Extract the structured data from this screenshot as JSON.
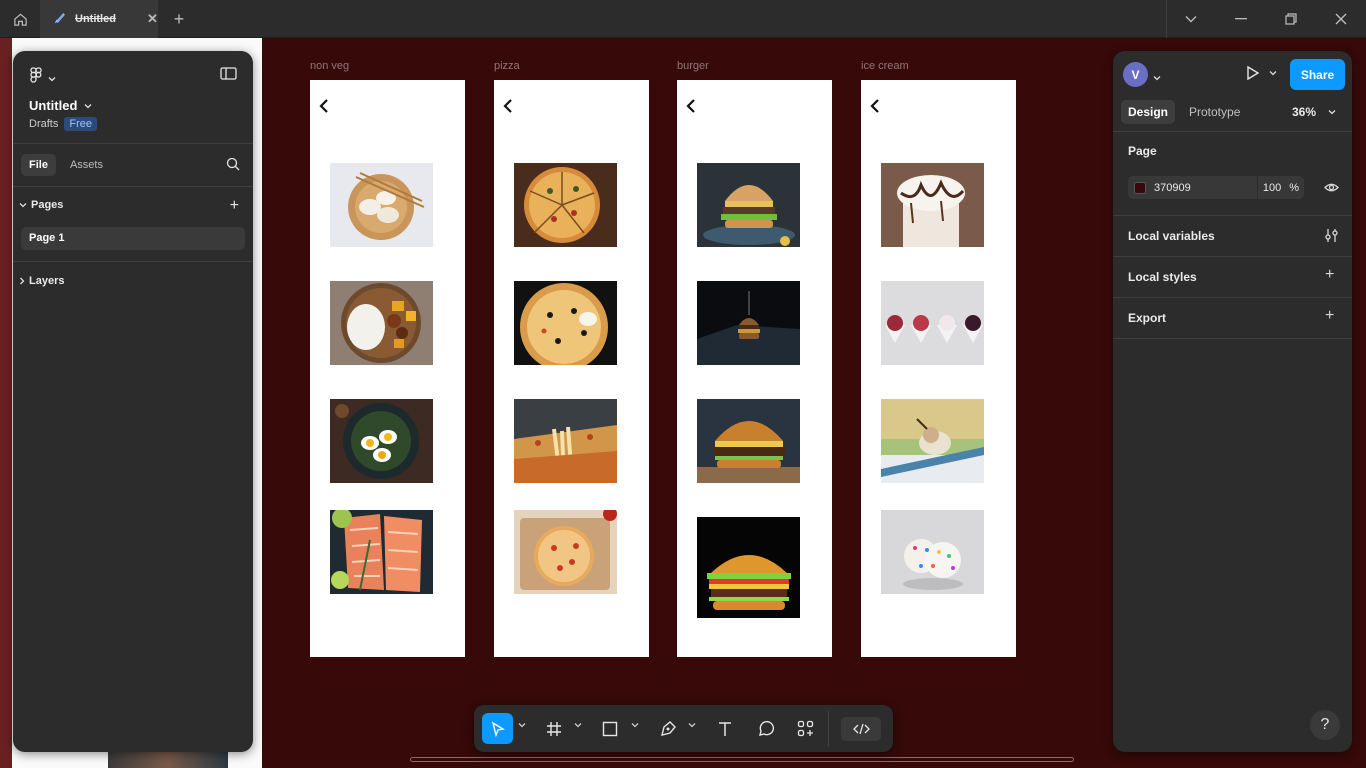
{
  "titlebar": {
    "tab_title": "Untitled",
    "tab_close": "✕",
    "new_tab": "+"
  },
  "file": {
    "name": "Untitled",
    "location": "Drafts",
    "plan_badge": "Free"
  },
  "left_panel": {
    "tabs": [
      "File",
      "Assets"
    ],
    "pages_header": "Pages",
    "add_symbol": "+",
    "pages": [
      "Page 1"
    ],
    "layers_header": "Layers"
  },
  "frames": [
    {
      "label": "non veg",
      "images": [
        "dumplings",
        "rice-bowl",
        "egg-salad",
        "salmon"
      ]
    },
    {
      "label": "pizza",
      "images": [
        "pizza-slices",
        "pizza-olive",
        "pizza-cheese-pull",
        "pizza-board"
      ]
    },
    {
      "label": "burger",
      "images": [
        "burger-plate",
        "burger-dark",
        "burger-classic",
        "burger-black-bg"
      ]
    },
    {
      "label": "ice cream",
      "images": [
        "sundae-chocolate",
        "ice-cream-cups",
        "ice-cream-window",
        "sprinkle-scoops"
      ]
    }
  ],
  "right_panel": {
    "avatar_initial": "V",
    "share_label": "Share",
    "tabs": [
      "Design",
      "Prototype"
    ],
    "zoom": "36%",
    "page_header": "Page",
    "page_color": "370909",
    "page_color_hex": "#370909",
    "page_opacity": "100",
    "percent_symbol": "%",
    "local_variables": "Local variables",
    "local_styles": "Local styles",
    "export": "Export",
    "help": "?"
  },
  "colors": {
    "canvas": "#370909",
    "panel": "#2c2c2c",
    "accent": "#0d99ff"
  },
  "toolbar_tools": [
    "move-tool",
    "frame-tool",
    "shape-tool",
    "pen-tool",
    "text-tool",
    "comment-tool",
    "actions-tool",
    "dev-mode-toggle"
  ]
}
